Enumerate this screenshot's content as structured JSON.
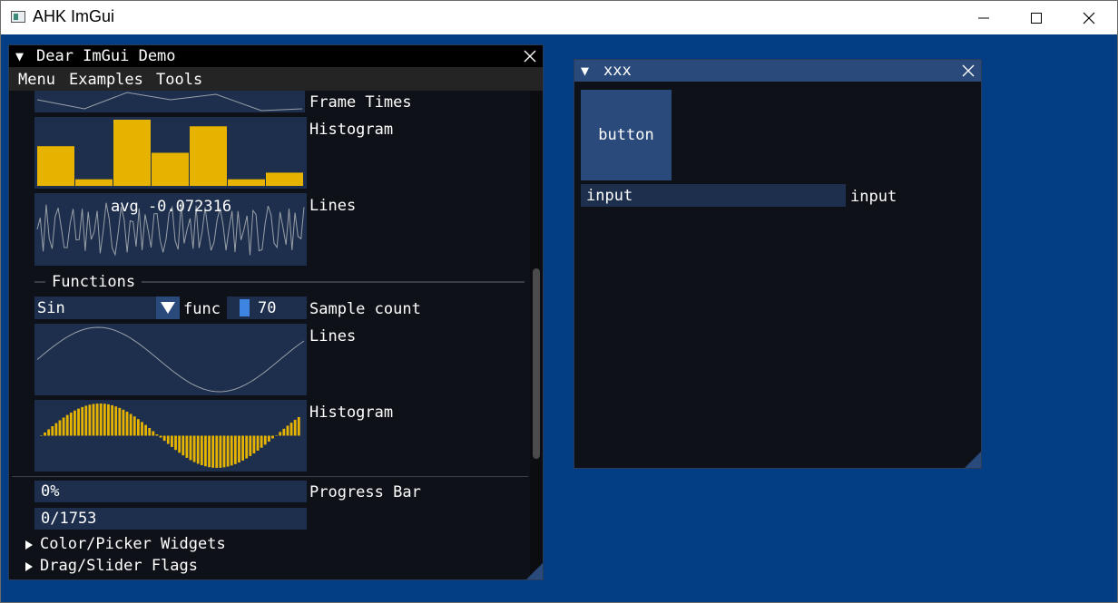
{
  "os_window": {
    "title": "AHK ImGui"
  },
  "demo": {
    "title": "Dear ImGui Demo",
    "menu": [
      "Menu",
      "Examples",
      "Tools"
    ],
    "frame_times_label": "Frame Times",
    "histogram_label": "Histogram",
    "lines_label": "Lines",
    "lines_overlay": "avg -0.072316",
    "functions_header": "Functions",
    "func_combo_value": "Sin",
    "func_label": "func",
    "sample_count_value": "70",
    "sample_count_label": "Sample count",
    "func_lines_label": "Lines",
    "func_histogram_label": "Histogram",
    "progress_value": "0%",
    "progress_count": "0/1753",
    "progress_label": "Progress Bar",
    "tree_color_picker": "Color/Picker Widgets",
    "tree_drag_slider": "Drag/Slider Flags"
  },
  "xxx": {
    "title": "xxx",
    "button_label": "button",
    "input_value": "input",
    "input_label": "input"
  },
  "colors": {
    "plot_bar": "#e6b400",
    "plot_line": "#9aa0a8",
    "frame_bg": "#1d2f4d",
    "title_active": "#294a7a"
  }
}
